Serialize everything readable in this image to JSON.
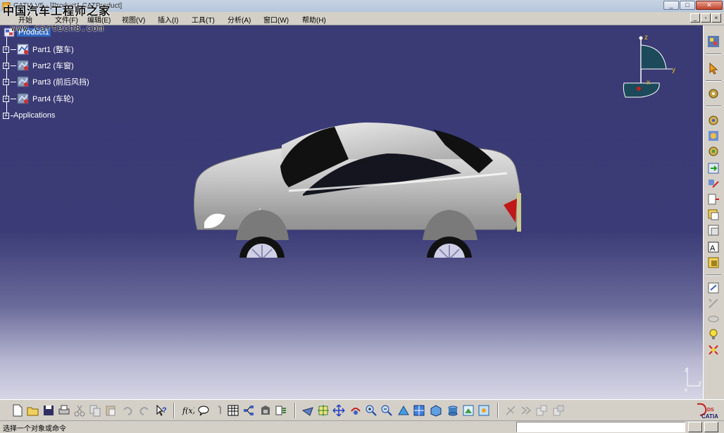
{
  "window": {
    "title": "CATIA V5 - [Product1.CATProduct]",
    "controls": [
      "_",
      "□",
      "✕"
    ]
  },
  "watermark": {
    "text": "中国汽车工程师之家",
    "url": "www.cartech8.com"
  },
  "menu": {
    "items": [
      "开始",
      "文件(F)",
      "编辑(E)",
      "视图(V)",
      "插入(I)",
      "工具(T)",
      "分析(A)",
      "窗口(W)",
      "帮助(H)"
    ]
  },
  "tree": {
    "root": "Product1",
    "nodes": [
      "Part1 (整车)",
      "Part2 (车窗)",
      "Part3 (前后风挡)",
      "Part4 (车轮)"
    ],
    "applications": "Applications"
  },
  "compass": {
    "axis_z": "z",
    "axis_y": "y",
    "axis_x": "x"
  },
  "triad": {
    "axis_y": "y",
    "axis_z": "z",
    "axis_x": "x"
  },
  "status": {
    "message": "选择一个对象或命令",
    "command_placeholder": ""
  },
  "brand": {
    "logo_text": "CATIA"
  },
  "icons": {
    "right_toolbar": [
      "catia-app-icon",
      "select-arrow-icon",
      "gear-icon",
      "assembly-gear-icon",
      "component-gear-icon",
      "component-gear2-icon",
      "insert-product-icon",
      "replace-component-icon",
      "reorder-icon",
      "graph-tree-icon",
      "generate-numbering-icon",
      "view-mode-icon",
      "manipulate-icon",
      "snap-icon",
      "explode-icon",
      "light-bulb-icon",
      "clash-icon"
    ],
    "bottom_toolbar": [
      "new-icon",
      "open-icon",
      "save-icon",
      "print-icon",
      "cut-icon",
      "copy-icon",
      "paste-icon",
      "undo-icon",
      "redo-icon",
      "whats-this-icon",
      "formula-icon",
      "comment-icon",
      "knowledge-icon",
      "table-icon",
      "tree-icon",
      "catalog-icon",
      "macro-icon",
      "fly-icon",
      "fit-all-icon",
      "pan-icon",
      "rotate-icon",
      "zoom-in-icon",
      "zoom-out-icon",
      "normal-view-icon",
      "views-icon",
      "render-style-icon",
      "hide-show-icon",
      "swap-icon",
      "screen-icon",
      "measure-icon",
      "measure-item-icon",
      "measure-inertia-icon"
    ]
  },
  "colors": {
    "viewport_top": "#3a3a74",
    "viewport_bottom": "#d6d6e6",
    "tree_selection": "#316ac5",
    "car_body": "#c4c4c4",
    "compass_fill": "#1c4a5a"
  }
}
